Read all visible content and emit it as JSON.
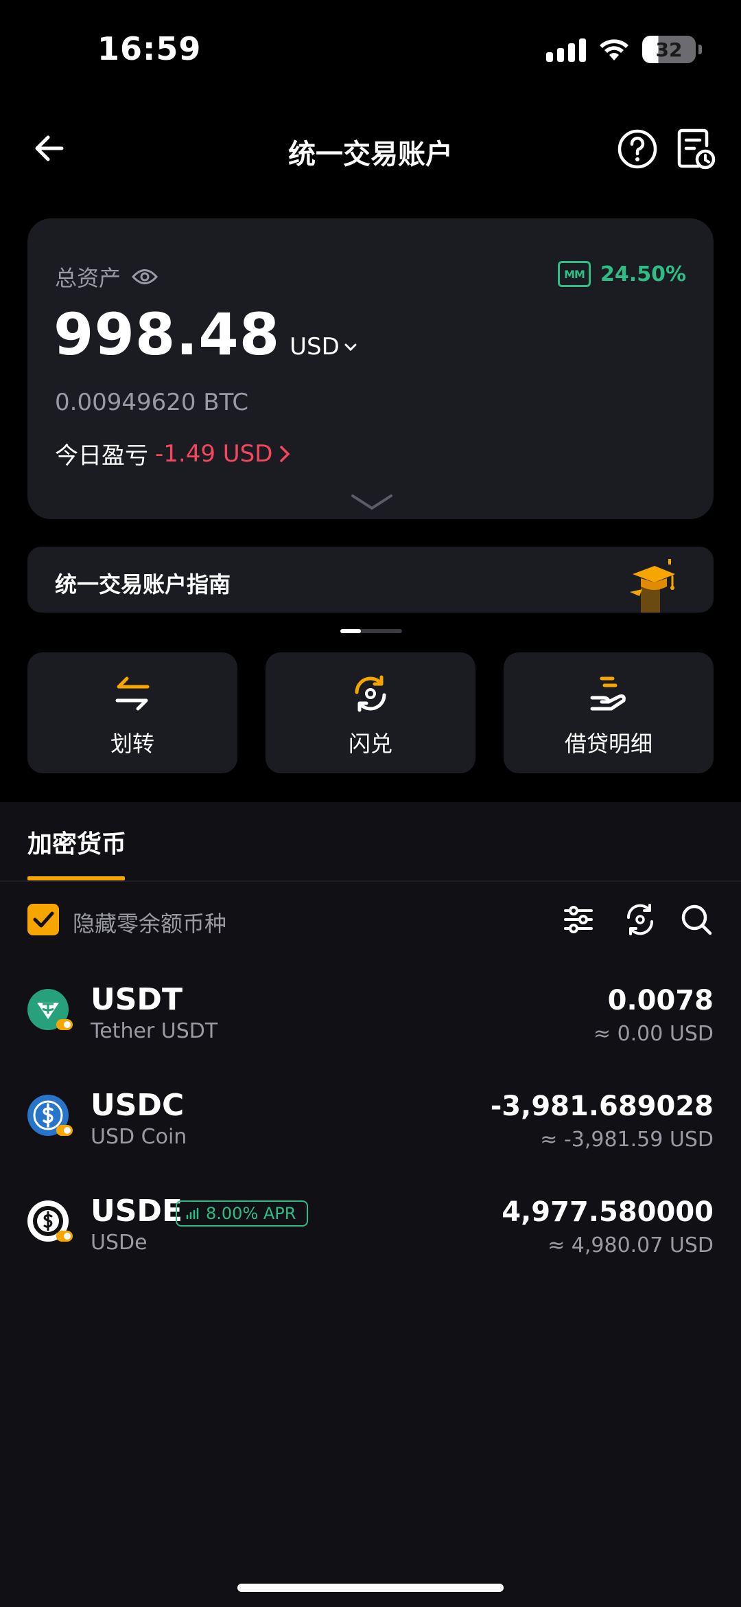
{
  "status_bar": {
    "time": "16:59",
    "battery": "32",
    "icons": [
      "signal-icon",
      "wifi-icon",
      "battery-icon"
    ]
  },
  "nav": {
    "title": "统一交易账户",
    "back_icon": "arrow-left-icon",
    "help_icon": "question-circle-icon",
    "history_icon": "document-clock-icon"
  },
  "asset_card": {
    "label": "总资产",
    "eye_icon": "eye-icon",
    "mm_badge": "MM",
    "mm_value": "24.50%",
    "amount": "998.48",
    "currency": "USD",
    "btc_value": "0.00949620 BTC",
    "pnl_label": "今日盈亏",
    "pnl_value": "-1.49 USD"
  },
  "guide": {
    "title": "统一交易账户指南"
  },
  "actions": [
    {
      "label": "划转",
      "icon": "transfer-arrows-icon"
    },
    {
      "label": "闪兑",
      "icon": "swap-icon"
    },
    {
      "label": "借贷明细",
      "icon": "loan-hand-icon"
    }
  ],
  "tabs": {
    "crypto": "加密货币"
  },
  "filters": {
    "hide_zero_label": "隐藏零余额币种",
    "hide_zero_checked": true
  },
  "coins": [
    {
      "symbol": "USDT",
      "name": "Tether USDT",
      "amount": "0.0078",
      "usd": "≈ 0.00 USD",
      "icon": "tether-icon"
    },
    {
      "symbol": "USDC",
      "name": "USD Coin",
      "amount": "-3,981.689028",
      "usd": "≈ -3,981.59 USD",
      "icon": "usdc-icon"
    },
    {
      "symbol": "USDE",
      "name": "USDe",
      "amount": "4,977.580000",
      "usd": "≈ 4,980.07 USD",
      "icon": "usde-icon",
      "apr_badge": "8.00% APR"
    }
  ],
  "colors": {
    "accent": "#f7a600",
    "positive": "#2ebd85",
    "negative": "#f6465d",
    "card_bg": "#1b1c22",
    "page_bg": "#101015"
  }
}
